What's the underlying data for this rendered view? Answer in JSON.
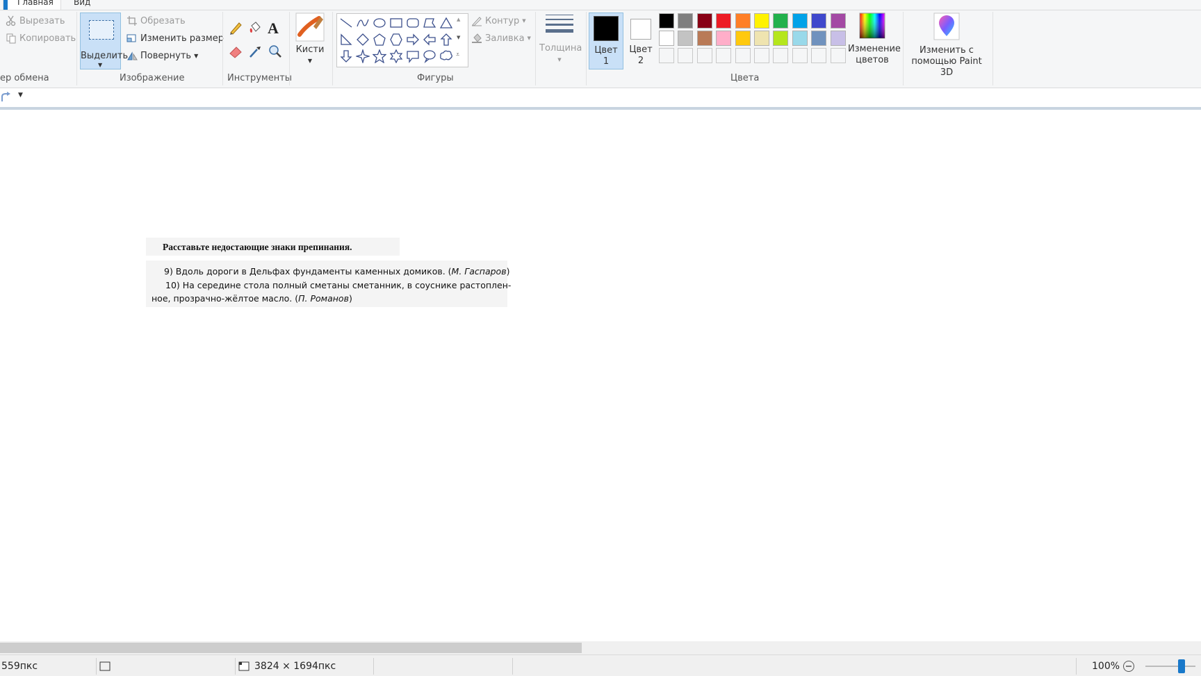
{
  "tabs": {
    "home": "Главная",
    "view": "Вид"
  },
  "clipboard": {
    "cut": "Вырезать",
    "copy": "Копировать",
    "label": "ер обмена"
  },
  "image": {
    "select": "Выделить",
    "crop": "Обрезать",
    "resize": "Изменить размер",
    "rotate": "Повернуть",
    "label": "Изображение"
  },
  "tools": {
    "label": "Инструменты"
  },
  "brushes": {
    "label": "Кисти"
  },
  "shapes": {
    "outline": "Контур",
    "fill": "Заливка",
    "label": "Фигуры"
  },
  "thickness": {
    "label": "Толщина"
  },
  "colors": {
    "color1_line1": "Цвет",
    "color1_line2": "1",
    "color2_line1": "Цвет",
    "color2_line2": "2",
    "edit_line1": "Изменение",
    "edit_line2": "цветов",
    "label": "Цвета",
    "color1": "#000000",
    "color2": "#ffffff",
    "palette_row1": [
      "#000000",
      "#7f7f7f",
      "#880015",
      "#ed1c24",
      "#ff7f27",
      "#fff200",
      "#22b14c",
      "#00a2e8",
      "#3f48cc",
      "#a349a4"
    ],
    "palette_row2": [
      "#ffffff",
      "#c3c3c3",
      "#b97a57",
      "#ffaec9",
      "#ffc90e",
      "#efe4b0",
      "#b5e61d",
      "#99d9ea",
      "#7092be",
      "#c8bfe7"
    ]
  },
  "paint3d": {
    "line1": "Изменить с",
    "line2": "помощью Paint 3D"
  },
  "document": {
    "heading": "Расставьте недостающие знаки препинания.",
    "line1": "9) Вдоль дороги в Дельфах фундаменты каменных домиков. (",
    "line1_author": "М. Гаспаров",
    "line2": "10) На середине стола полный сметаны сметанник, в соуснике растоплен-",
    "line3": "ное, прозрачно-жёлтое масло. (",
    "line3_author": "П. Романов",
    "close_paren": ")"
  },
  "status": {
    "position": "559пкс",
    "size": "3824 × 1694пкс",
    "zoom": "100%"
  }
}
